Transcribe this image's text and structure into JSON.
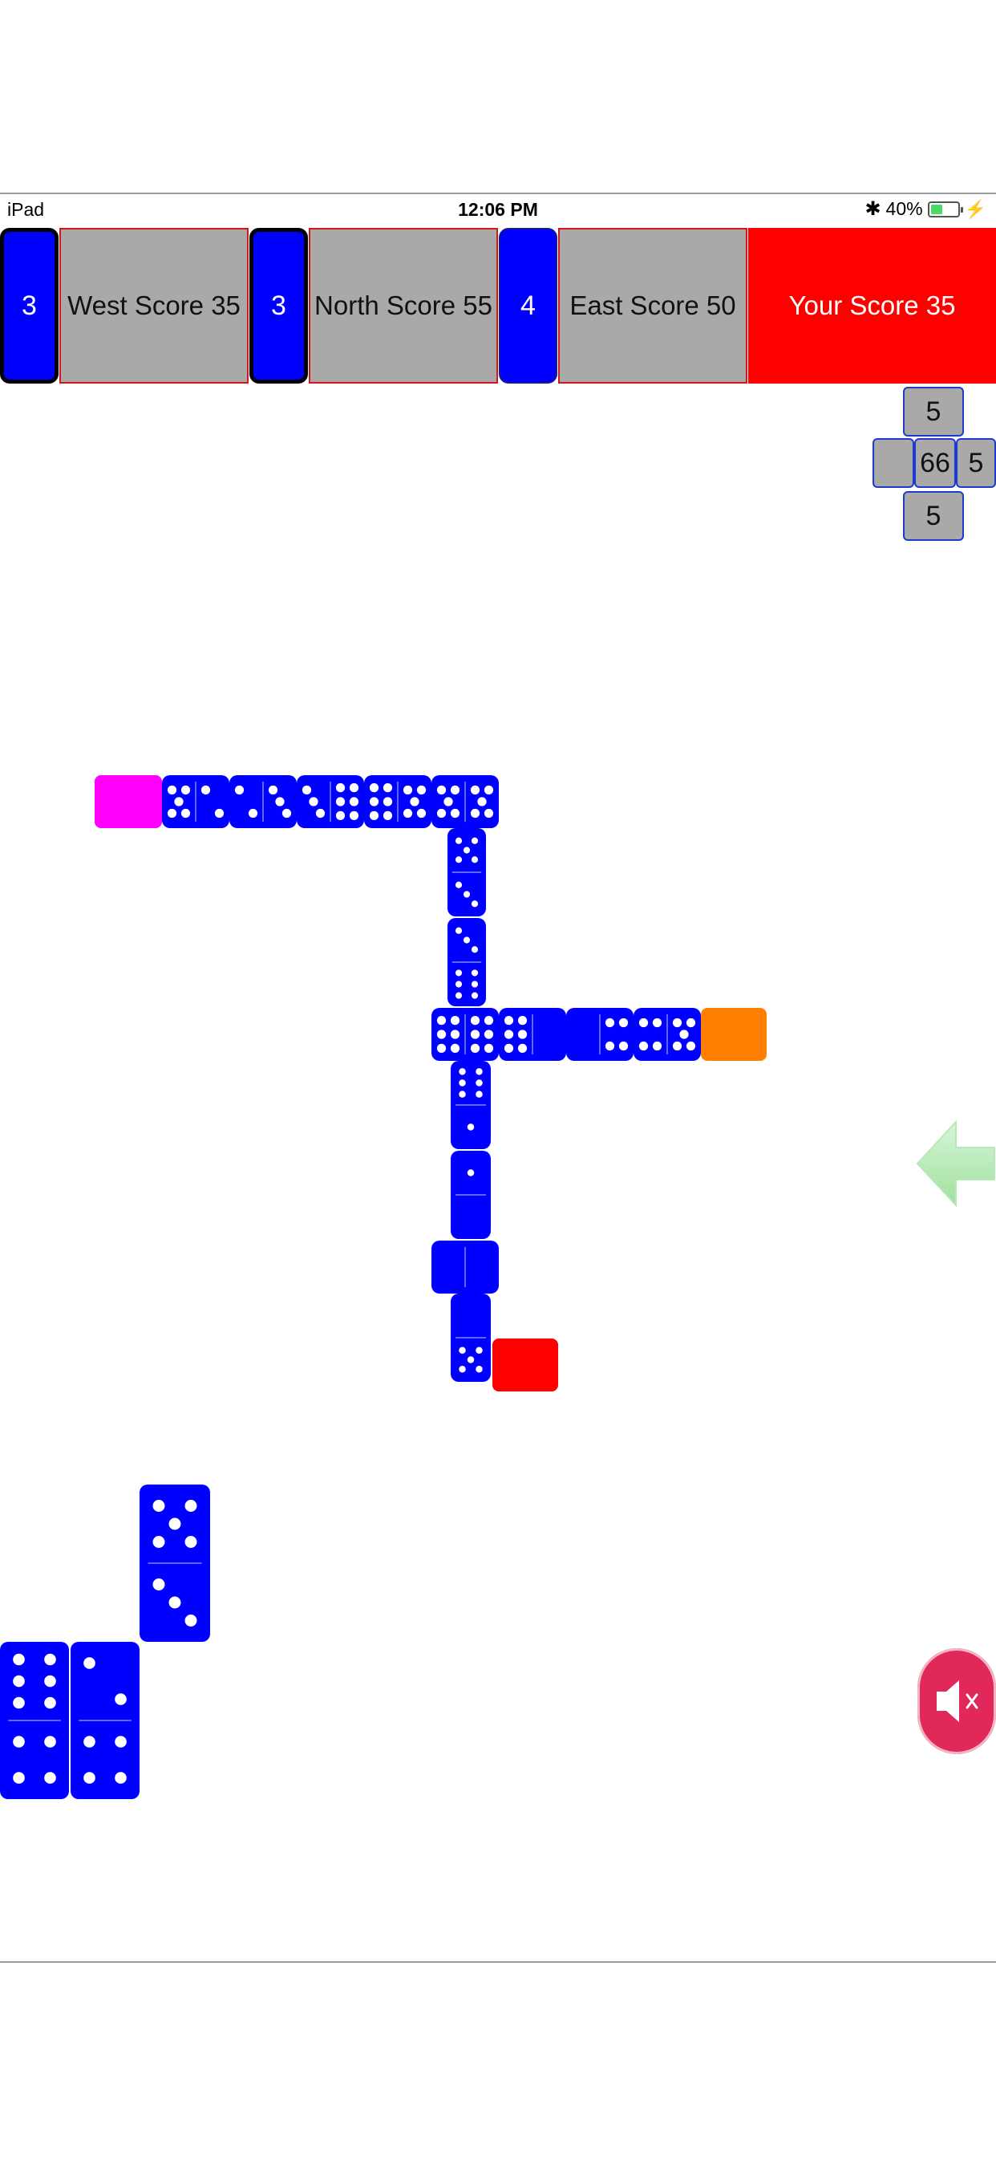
{
  "status_bar": {
    "device": "iPad",
    "time": "12:06 PM",
    "battery": "40%",
    "battery_level": 0.4
  },
  "players": {
    "west": {
      "tiles_left": "3",
      "score_label": "West Score 35"
    },
    "north": {
      "tiles_left": "3",
      "score_label": "North Score 55"
    },
    "east": {
      "tiles_left": "4",
      "score_label": "East Score 50"
    },
    "you": {
      "score_label": "Your Score 35"
    }
  },
  "ends": {
    "top": "5",
    "center": "66",
    "right": "5",
    "bottom": "5",
    "left": ""
  },
  "board_tiles": [
    {
      "a": 5,
      "b": 2
    },
    {
      "a": 2,
      "b": 3
    },
    {
      "a": 3,
      "b": 6
    },
    {
      "a": 6,
      "b": 5
    },
    {
      "a": 5,
      "b": 5
    },
    {
      "a": 5,
      "b": 3
    },
    {
      "a": 3,
      "b": 6
    },
    {
      "a": 6,
      "b": 6
    },
    {
      "a": 6,
      "b": 0
    },
    {
      "a": 0,
      "b": 4
    },
    {
      "a": 4,
      "b": 5
    },
    {
      "a": 6,
      "b": 1
    },
    {
      "a": 1,
      "b": 0
    },
    {
      "a": 0,
      "b": 0
    },
    {
      "a": 0,
      "b": 5
    }
  ],
  "hand_tiles": [
    {
      "a": 5,
      "b": 3
    },
    {
      "a": 6,
      "b": 4
    },
    {
      "a": 2,
      "b": 4
    }
  ],
  "colors": {
    "tile": "#0000ff",
    "west_end": "#ff00ff",
    "east_end": "#ff8000",
    "south_end": "#ff0000",
    "your_score": "#ff0000",
    "mute_button": "#e0285a"
  },
  "icons": {
    "back": "left-arrow-icon",
    "mute": "speaker-mute-icon"
  }
}
